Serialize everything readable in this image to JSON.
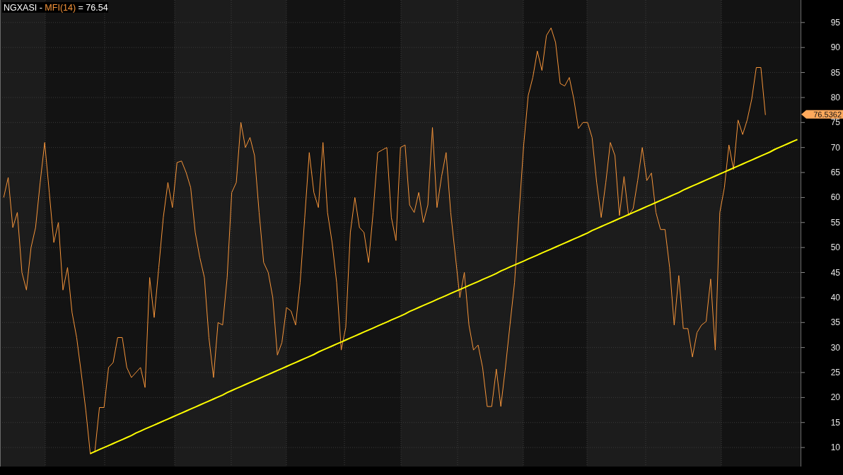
{
  "chart": {
    "legend": {
      "symbol": "NGXASI -",
      "reading": "= 76.54"
    },
    "last_value_label": "76.5362",
    "chart_data": {
      "type": "line",
      "ylim": [
        6.2,
        99.5
      ],
      "yticks": [
        10,
        15,
        20,
        25,
        30,
        35,
        40,
        45,
        50,
        55,
        60,
        65,
        70,
        75,
        80,
        85,
        90,
        95
      ],
      "grid": true,
      "series": [
        {
          "name": "MFI(14)",
          "color": "#f7953a",
          "values": [
            60,
            64,
            54,
            57,
            45,
            41.5,
            50,
            54,
            63,
            71,
            61,
            51,
            55,
            41.5,
            46,
            37,
            32,
            25,
            17.5,
            8.7,
            9.3,
            18,
            18,
            26,
            27,
            32,
            32,
            26,
            24,
            25,
            26,
            22,
            44,
            36,
            46,
            56,
            63,
            58,
            67,
            67.3,
            65,
            62,
            53,
            48,
            44,
            32,
            24,
            35,
            34.5,
            44,
            61,
            63,
            75,
            70,
            72,
            68.4,
            57,
            47,
            45,
            40,
            28.5,
            31,
            38,
            37.3,
            34.5,
            43,
            56,
            69,
            61,
            58,
            71,
            57,
            51,
            43,
            29.5,
            34,
            53,
            60,
            54,
            53,
            47,
            57,
            69,
            69.5,
            70,
            56,
            51.4,
            70,
            70.5,
            58.5,
            57,
            61,
            55,
            58.5,
            74,
            58,
            64.2,
            69,
            57,
            48.6,
            40,
            45,
            34.5,
            29.5,
            30.5,
            26,
            18.2,
            18.2,
            25.7,
            18.2,
            26,
            34.5,
            43,
            57,
            70.5,
            80.4,
            84,
            89.3,
            85.4,
            92.4,
            93.9,
            91,
            82.8,
            82.3,
            84,
            79.7,
            73.8,
            75,
            75,
            72,
            63,
            56,
            63,
            71,
            68.4,
            56.4,
            64.2,
            56.4,
            57.8,
            63.4,
            70,
            63.4,
            64.9,
            57,
            53.6,
            53.6,
            46,
            34.5,
            44.4,
            33.8,
            33.8,
            28.1,
            33,
            34.5,
            35.2,
            43.7,
            29.5,
            57,
            62,
            70.5,
            65.6,
            75.5,
            72.6,
            75.5,
            79.7,
            86,
            86,
            76.5
          ]
        },
        {
          "color": "#ffff00",
          "values": [
            null,
            null,
            null,
            null,
            null,
            null,
            null,
            null,
            null,
            null,
            null,
            null,
            null,
            null,
            null,
            null,
            null,
            null,
            null,
            8.8,
            9.2,
            9.6,
            10.0,
            10.4,
            10.8,
            11.2,
            11.6,
            12.0,
            12.4,
            12.9,
            13.3,
            13.7,
            14.1,
            14.5,
            14.9,
            15.3,
            15.7,
            16.1,
            16.5,
            16.9,
            17.3,
            17.7,
            18.1,
            18.5,
            18.9,
            19.3,
            19.7,
            20.1,
            20.5,
            21.0,
            21.4,
            21.8,
            22.2,
            22.6,
            23.0,
            23.4,
            23.8,
            24.2,
            24.6,
            25.0,
            25.4,
            25.8,
            26.2,
            26.6,
            27.0,
            27.4,
            27.8,
            28.2,
            28.6,
            29.1,
            29.5,
            29.9,
            30.3,
            30.7,
            31.1,
            31.5,
            31.9,
            32.3,
            32.7,
            33.1,
            33.5,
            33.9,
            34.3,
            34.7,
            35.1,
            35.5,
            35.9,
            36.3,
            36.7,
            37.2,
            37.6,
            38.0,
            38.4,
            38.8,
            39.2,
            39.6,
            40.0,
            40.4,
            40.8,
            41.2,
            41.6,
            42.0,
            42.4,
            42.8,
            43.2,
            43.6,
            44.0,
            44.4,
            44.8,
            45.3,
            45.7,
            46.1,
            46.5,
            46.9,
            47.3,
            47.7,
            48.1,
            48.5,
            48.9,
            49.3,
            49.7,
            50.1,
            50.5,
            50.9,
            51.3,
            51.7,
            52.1,
            52.5,
            52.9,
            53.4,
            53.8,
            54.2,
            54.6,
            55.0,
            55.4,
            55.8,
            56.2,
            56.6,
            57.0,
            57.4,
            57.8,
            58.2,
            58.6,
            59.0,
            59.4,
            59.8,
            60.2,
            60.6,
            61.0,
            61.5,
            61.9,
            62.3,
            62.7,
            63.1,
            63.5,
            63.9,
            64.3,
            64.7,
            65.1,
            65.5,
            65.9,
            66.3,
            66.7,
            67.1,
            67.5,
            67.9,
            68.3,
            68.7,
            69.1,
            69.6,
            70.0,
            70.4,
            70.8,
            71.2,
            71.6
          ]
        }
      ]
    }
  }
}
